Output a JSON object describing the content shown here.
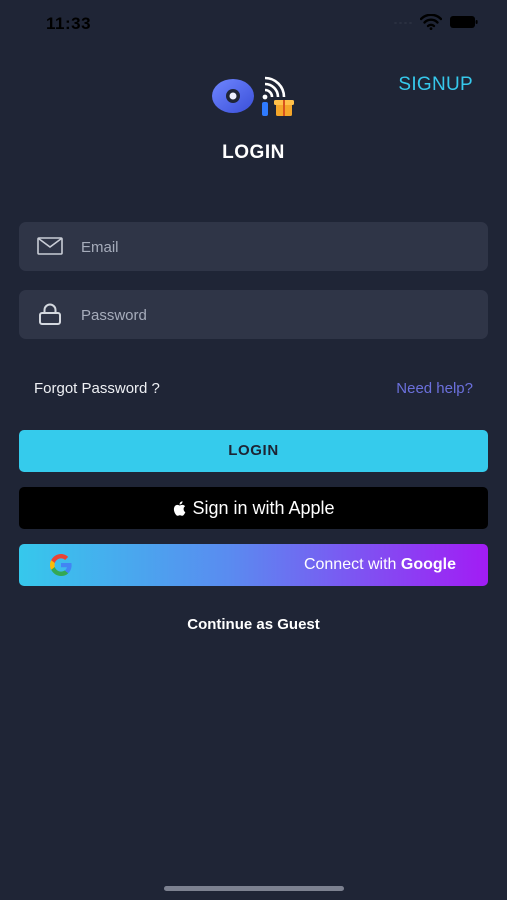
{
  "status_bar": {
    "time": "11:33"
  },
  "header": {
    "signup_label": "SIGNUP",
    "title": "LOGIN"
  },
  "form": {
    "email": {
      "placeholder": "Email",
      "value": ""
    },
    "password": {
      "placeholder": "Password",
      "value": ""
    },
    "forgot_label": "Forgot Password ?",
    "help_label": "Need help?"
  },
  "buttons": {
    "login_label": "LOGIN",
    "apple_label": "Sign in with Apple",
    "google_prefix": "Connect with ",
    "google_brand": "Google",
    "guest_label": "Continue as Guest"
  },
  "icons": [
    "wifi-icon",
    "battery-icon",
    "mail-icon",
    "lock-icon",
    "apple-icon",
    "google-icon"
  ],
  "colors": {
    "background": "#1f2536",
    "field": "#2f3547",
    "accent": "#36c9ec",
    "help": "#6b70dc",
    "google_gradient_end": "#a21cf4"
  }
}
